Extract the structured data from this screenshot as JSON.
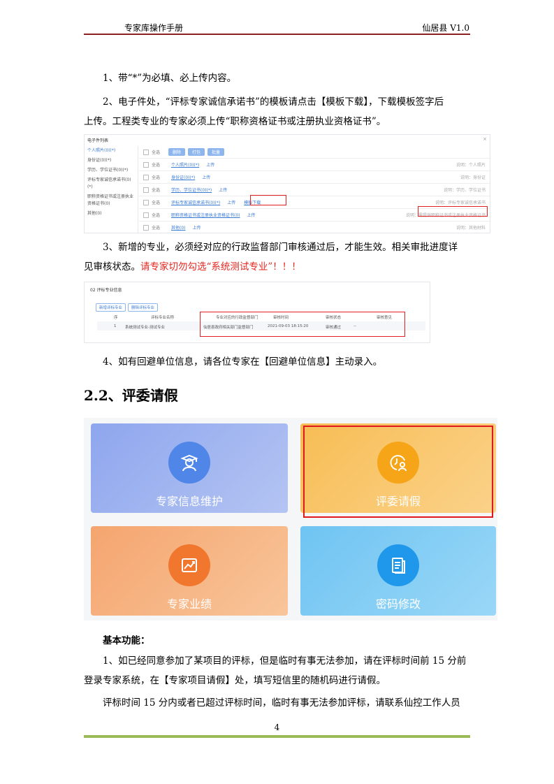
{
  "header": {
    "left": "专家库操作手册",
    "right": "仙居县   V1.0"
  },
  "paragraphs": {
    "p1": "1、带“*”为必填、必上传内容。",
    "p2a": "2、电子件处，“评标专家诚信承诺书”的模板请点击【模板下载】，下载模板签字后",
    "p2b": "上传。工程类专业的专家必须上传“职称资格证书或注册执业资格证书”。",
    "p3a": "3、新增的专业，必须经对应的行政监督部门审核通过后，才能生效。相关审批进度详",
    "p3b_black": "见审核状态。",
    "p3b_red": "请专家切勿勾选“系统测试专业”！！！",
    "p4": "4、如有回避单位信息，请各位专家在【回避单位信息】主动录入。"
  },
  "section_title": "2.2、评委请假",
  "screenshot1": {
    "title": "电子件列表",
    "sidebar": [
      "个人照片(0)(*)",
      "身份证(0)(*)",
      "学历、学位证书(0)(*)",
      "评标专家诚信承诺书(0)(*)",
      "职称资格证书或注册执业资格证书(0)",
      "其他(0)"
    ],
    "toolbar": [
      "全选",
      "删除",
      "打包",
      "批量"
    ],
    "rows": [
      {
        "check": "全选",
        "link": "个人照片(0)(*)",
        "up": "上传",
        "hint": "说明：个人照片"
      },
      {
        "check": "全选",
        "link": "身份证(0)(*)",
        "up": "上传",
        "hint": "说明：身份证"
      },
      {
        "check": "全选",
        "link": "学历、学位证书(0)(*)",
        "up": "上传",
        "hint": "说明：学历、学位证书"
      },
      {
        "check": "全选",
        "link": "评标专家诚信承诺书(0)(*)",
        "up": "上传",
        "extra": "模板下载",
        "hint": "说明：评标专家诚信承诺书"
      },
      {
        "check": "全选",
        "link": "职称资格证书或注册执业资格证书(0)",
        "up": "上传",
        "hint": "说明：需提供职称证书或注册执业资格证书"
      },
      {
        "check": "全选",
        "link": "其他(0)",
        "up": "上传",
        "hint": "说明：其他材料"
      }
    ]
  },
  "screenshot2": {
    "title": "02  评标专业信息",
    "buttons": [
      "新增评标专业",
      "删除评标专业"
    ],
    "headers": [
      "序",
      "评标专业名称",
      "专业对应的行政监督部门",
      "审核时间",
      "审核状态",
      "审核意见"
    ],
    "row": [
      "1",
      "系统测试专业-测试专业",
      "仙居县政府相关部门监督部门",
      "2021-09-03 18:15:20",
      "审核通过",
      "--"
    ]
  },
  "tiles": [
    {
      "label": "专家信息维护",
      "icon": "expert-graduate-icon"
    },
    {
      "label": "评委请假",
      "icon": "clock-user-icon"
    },
    {
      "label": "专家业绩",
      "icon": "chart-trend-icon"
    },
    {
      "label": "密码修改",
      "icon": "document-icon"
    }
  ],
  "basic": {
    "title": "基本功能：",
    "p1a": "1、如已经同意参加了某项目的评标，但是临时有事无法参加，请在评标时间前 15 分前",
    "p1b": "登录专家系统，在【专家项目请假】处，填写短信里的随机码进行请假。",
    "p2": "评标时间 15 分内或者已超过评标时间，临时有事无法参加评标，请联系仙控工作人员"
  },
  "footer": {
    "page": "4"
  },
  "colors": {
    "header_line": "#8c1f1f",
    "footer_line": "#9bbb59",
    "highlight": "#e02020"
  }
}
